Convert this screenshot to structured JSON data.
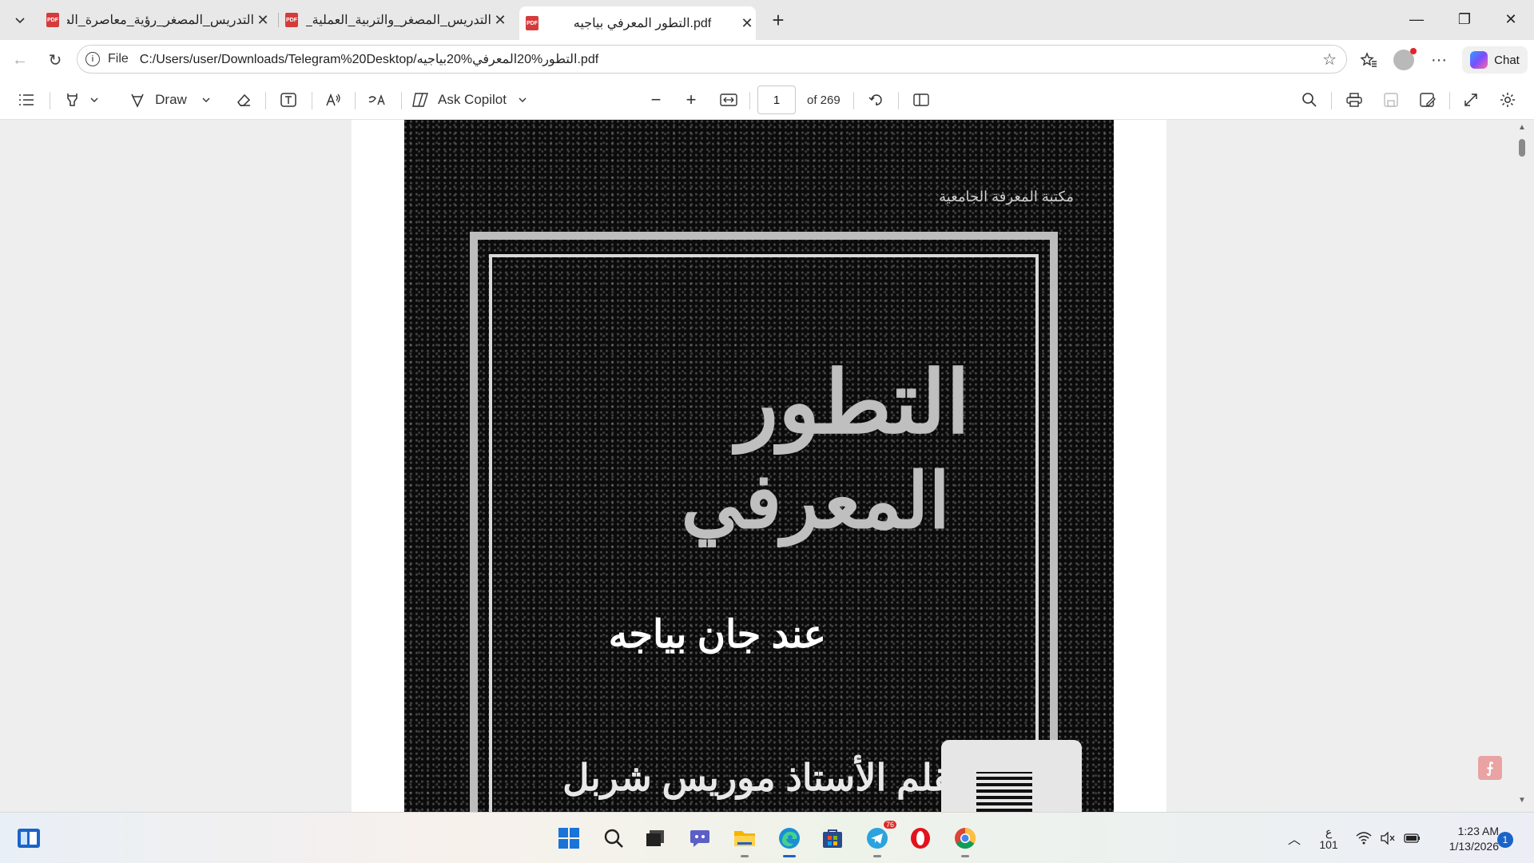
{
  "tabs": [
    {
      "title": "التدريس_المصغر_رؤية_معاصرة_الصا",
      "close": "✕"
    },
    {
      "title": "التدريس_المصغر_والتربية_العملية_الـ",
      "close": "✕"
    },
    {
      "title": "التطور المعرفي بياجيه.pdf",
      "close": "✕"
    }
  ],
  "tab_favicon": "PDF",
  "new_tab": "+",
  "window_controls": {
    "minimize": "—",
    "restore": "❐",
    "close": "✕"
  },
  "address": {
    "scheme": "File",
    "url": "C:/Users/user/Downloads/Telegram%20Desktop/التطور%20المعرفي%20بياجيه.pdf",
    "info": "i"
  },
  "nav": {
    "back": "←",
    "refresh": "↻",
    "more": "···",
    "chat_label": "Chat"
  },
  "toolbar": {
    "draw_label": "Draw",
    "ask_copilot_label": "Ask Copilot",
    "page_current": "1",
    "page_total": "of 269"
  },
  "document": {
    "top_text": "مكتبة المعرفة الجامعية",
    "title_line1": "التطور",
    "title_line2": "المعرفي",
    "subtitle": "عند جان بياجه",
    "bottom_text": "بقلم الأستاذ موريس شربل"
  },
  "taskbar": {
    "telegram_badge": "76",
    "ime_line1": "ع",
    "ime_line2": "101",
    "time": "1:23 AM",
    "date": "1/13/2026",
    "notifications": "1"
  },
  "icons": {
    "tab_list": "chevron-down-icon",
    "favorite": "star-icon",
    "favorites_bar": "favorites-icon",
    "search": "search-icon",
    "settings": "gear-icon"
  },
  "colors": {
    "pdf_favicon": "#d63b3b",
    "active_indicator": "#1a64c8",
    "notif_dot": "#e0242a"
  }
}
